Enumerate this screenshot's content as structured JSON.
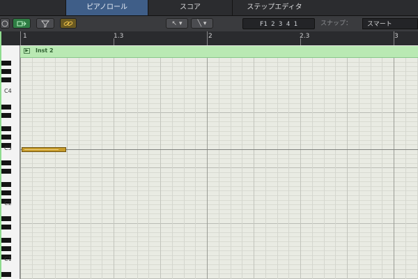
{
  "tabs": [
    {
      "label": "ピアノロール",
      "active": true
    },
    {
      "label": "スコア",
      "active": false
    },
    {
      "label": "ステップエディタ",
      "active": false
    }
  ],
  "toolbar": {
    "pointer_symbol": "↖",
    "pencil_symbol": "╲",
    "dropdown_symbol": "▾",
    "position": "F1  2 3 4 1",
    "snap_label": "スナップ：",
    "snap_value": "スマート"
  },
  "ruler": {
    "bar_labels": [
      "1",
      "1.3",
      "2",
      "2.3",
      "3"
    ]
  },
  "keyboard": {
    "octave_labels": [
      "C4",
      "C3",
      "C2",
      "C1"
    ]
  },
  "region": {
    "name": "Inst 2"
  },
  "colors": {
    "active_tab": "#3f5e88",
    "region": "#b9e9b3",
    "note": "#c69b2a",
    "grid_background": "#e9ebe3"
  },
  "icons": [
    "loop-icon",
    "forward-arrow-icon",
    "filter-icon",
    "link-icon",
    "pointer-tool-icon",
    "pencil-tool-icon"
  ]
}
